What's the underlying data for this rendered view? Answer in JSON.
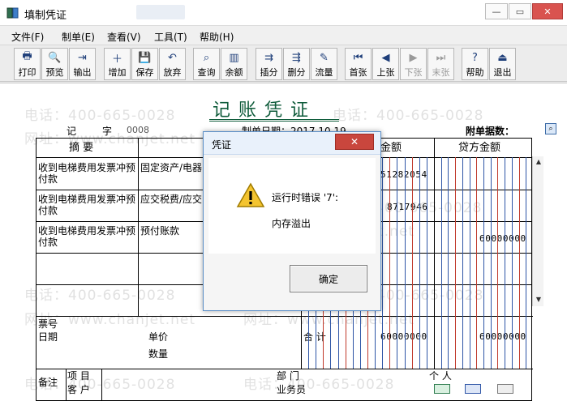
{
  "window": {
    "title": "填制凭证",
    "min": "—",
    "max": "▭",
    "close": "✕"
  },
  "menu": [
    "文件(F)",
    "制单(E)",
    "查看(V)",
    "工具(T)",
    "帮助(H)"
  ],
  "toolbar": [
    {
      "label": "打印",
      "icon": "printer-icon",
      "glyph": "🖶",
      "disabled": false
    },
    {
      "label": "预览",
      "icon": "preview-icon",
      "glyph": "🔍",
      "disabled": false
    },
    {
      "label": "输出",
      "icon": "export-icon",
      "glyph": "⇥",
      "disabled": false
    },
    {
      "label": "增加",
      "icon": "add-icon",
      "glyph": "＋",
      "disabled": false
    },
    {
      "label": "保存",
      "icon": "save-icon",
      "glyph": "💾",
      "disabled": false
    },
    {
      "label": "放弃",
      "icon": "undo-icon",
      "glyph": "↶",
      "disabled": false
    },
    {
      "label": "查询",
      "icon": "binoculars-icon",
      "glyph": "⌕",
      "disabled": false
    },
    {
      "label": "余额",
      "icon": "bar-chart-icon",
      "glyph": "▥",
      "disabled": false
    },
    {
      "label": "插分",
      "icon": "insert-row-icon",
      "glyph": "⇉",
      "disabled": false
    },
    {
      "label": "删分",
      "icon": "delete-row-icon",
      "glyph": "⇶",
      "disabled": false
    },
    {
      "label": "流量",
      "icon": "flow-icon",
      "glyph": "✎",
      "disabled": false
    },
    {
      "label": "首张",
      "icon": "first-record-icon",
      "glyph": "⏮",
      "disabled": false
    },
    {
      "label": "上张",
      "icon": "previous-record-icon",
      "glyph": "◀",
      "disabled": false
    },
    {
      "label": "下张",
      "icon": "next-record-icon",
      "glyph": "▶",
      "disabled": true
    },
    {
      "label": "末张",
      "icon": "last-record-icon",
      "glyph": "⏭",
      "disabled": true
    },
    {
      "label": "帮助",
      "icon": "help-icon",
      "glyph": "?",
      "disabled": false
    },
    {
      "label": "退出",
      "icon": "exit-icon",
      "glyph": "⏏",
      "disabled": false
    }
  ],
  "voucher": {
    "title": "记账凭证",
    "ji": "记",
    "zi": "字",
    "number": "0008",
    "date": "制单日期：2017.10.19",
    "attachments": "附单据数：",
    "headers": {
      "summary": "摘 要",
      "debit": "金额",
      "credit": "贷方金额"
    },
    "rows": [
      {
        "summary": "收到电梯费用发票冲预付款",
        "account": "固定资产/电器",
        "debit": "51282054",
        "credit": ""
      },
      {
        "summary": "收到电梯费用发票冲预付款",
        "account": "应交税费/应交",
        "debit": "8717946",
        "credit": ""
      },
      {
        "summary": "收到电梯费用发票冲预付款",
        "account": "预付账款",
        "debit": "",
        "credit": "60000000"
      }
    ],
    "footer": {
      "ticket": "票号",
      "date": "日期",
      "price": "单价",
      "qty": "数量",
      "total": "合 计",
      "total_debit": "60000000",
      "total_credit": "60000000",
      "remark": "备注",
      "project": "项 目",
      "customer": "客 户",
      "dept": "部 门",
      "person": "个 人",
      "clerk": "业务员"
    }
  },
  "watermark": {
    "phone": "电话：400-665-0028",
    "site": "网址：www.chanjet.net"
  },
  "dialog": {
    "title": "凭证",
    "close": "✕",
    "message": "运行时错误 '7':",
    "detail": "内存溢出",
    "ok": "确定"
  }
}
